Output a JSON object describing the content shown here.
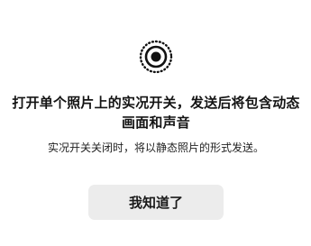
{
  "dialog": {
    "icon": "live-photo-icon",
    "title": "打开单个照片上的实况开关，发送后将包含动态画面和声音",
    "description": "实况开关关闭时，将以静态照片的形式发送。",
    "button_label": "我知道了"
  },
  "colors": {
    "background": "#ffffff",
    "button_bg": "#ececec",
    "text_primary": "#141414"
  }
}
